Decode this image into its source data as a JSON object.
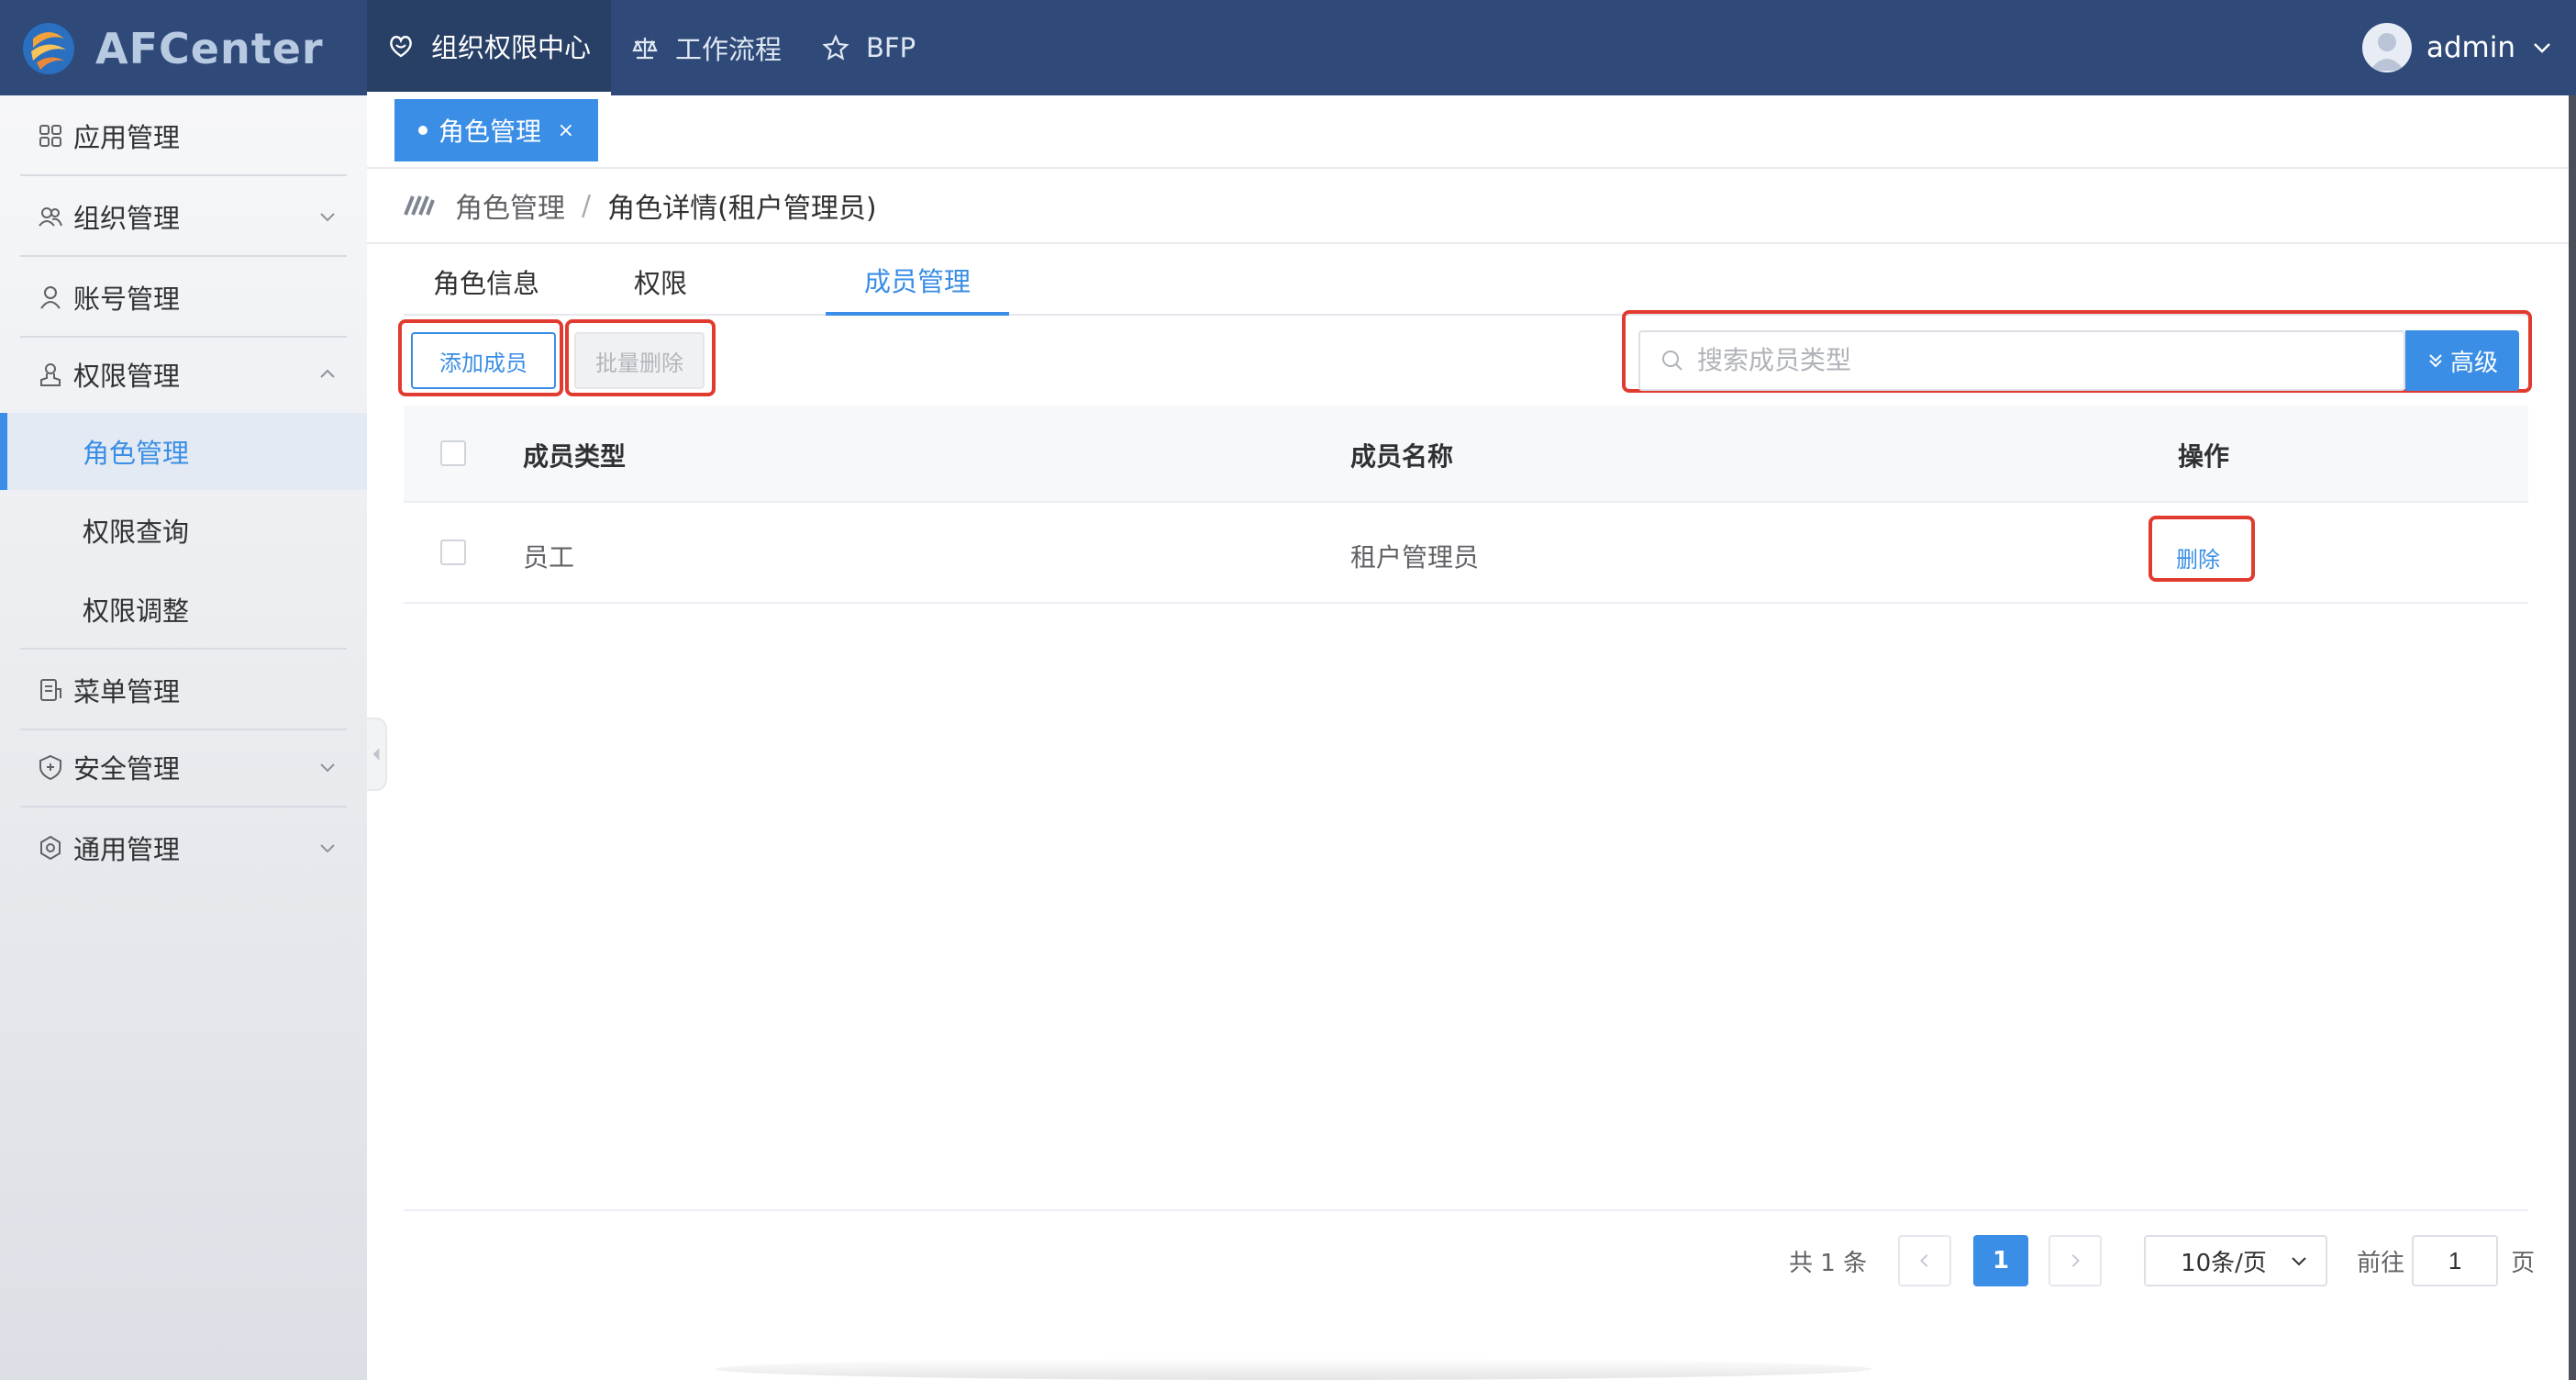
{
  "app": {
    "brand": "AFCenter"
  },
  "nav": [
    {
      "label": "组织权限中心",
      "icon": "heart-shield-icon",
      "active": true
    },
    {
      "label": "工作流程",
      "icon": "scale-icon",
      "active": false
    },
    {
      "label": "BFP",
      "icon": "star-icon",
      "active": false
    }
  ],
  "user": {
    "name": "admin"
  },
  "sidebar": {
    "items": [
      {
        "label": "应用管理",
        "icon": "apps-icon"
      },
      {
        "label": "组织管理",
        "icon": "users-icon"
      },
      {
        "label": "账号管理",
        "icon": "user-icon"
      },
      {
        "label": "权限管理",
        "icon": "permission-icon"
      },
      {
        "label": "菜单管理",
        "icon": "menu-doc-icon"
      },
      {
        "label": "安全管理",
        "icon": "shield-icon"
      },
      {
        "label": "通用管理",
        "icon": "settings-icon"
      }
    ],
    "sub_items": [
      {
        "label": "角色管理",
        "active": true
      },
      {
        "label": "权限查询",
        "active": false
      },
      {
        "label": "权限调整",
        "active": false
      }
    ]
  },
  "page_tab": {
    "label": "角色管理",
    "close": "×"
  },
  "breadcrumb": {
    "parent": "角色管理",
    "separator": "/",
    "current": "角色详情(租户管理员)"
  },
  "tabs": [
    {
      "label": "角色信息",
      "active": false
    },
    {
      "label": "权限",
      "active": false
    },
    {
      "label": "成员管理",
      "active": true
    }
  ],
  "toolbar": {
    "add_label": "添加成员",
    "batch_delete_label": "批量删除",
    "search_placeholder": "搜索成员类型",
    "advanced_label": "高级"
  },
  "table": {
    "columns": [
      "成员类型",
      "成员名称",
      "操作"
    ],
    "rows": [
      {
        "type": "员工",
        "name": "租户管理员",
        "action": "删除"
      }
    ]
  },
  "pagination": {
    "total_text": "共 1 条",
    "current_page": "1",
    "page_size": "10条/页",
    "goto_prefix": "前往",
    "goto_value": "1",
    "goto_suffix": "页"
  },
  "colors": {
    "header": "#2f4a78",
    "accent": "#3a8ee6",
    "highlight": "#e13b2f"
  }
}
